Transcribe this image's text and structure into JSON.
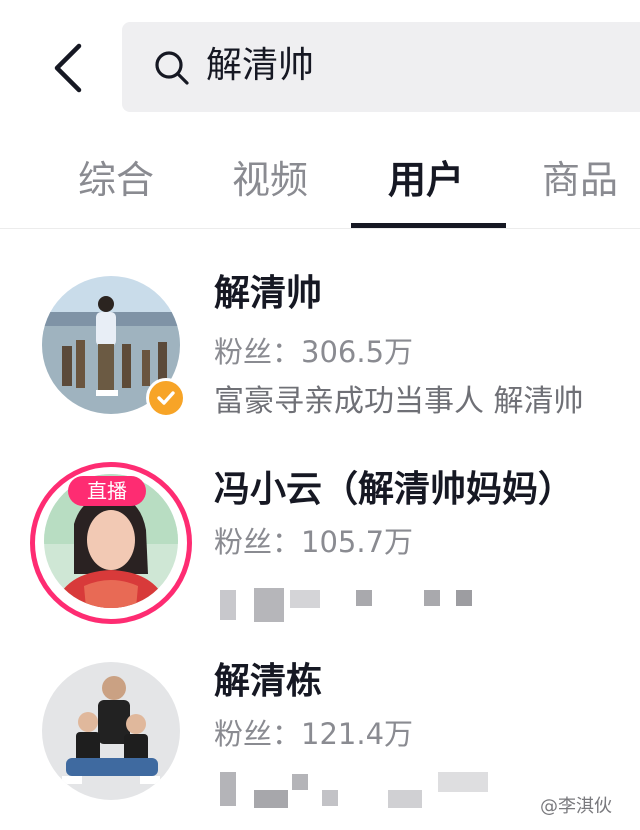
{
  "search": {
    "query": "解清帅"
  },
  "tabs": [
    {
      "label": "综合",
      "active": false
    },
    {
      "label": "视频",
      "active": false
    },
    {
      "label": "用户",
      "active": true
    },
    {
      "label": "商品",
      "active": false
    }
  ],
  "users": [
    {
      "name": "解清帅",
      "fans": "粉丝：306.5万",
      "desc": "富豪寻亲成功当事人 解清帅",
      "verified": true,
      "live": false
    },
    {
      "name": "冯小云（解清帅妈妈）",
      "fans": "粉丝：105.7万",
      "live": true,
      "live_label": "直播"
    },
    {
      "name": "解清栋",
      "fans": "粉丝：121.4万",
      "live": false
    }
  ],
  "watermark": "@李淇伙",
  "colors": {
    "accent_pink": "#fe2c72",
    "verified_orange": "#f7a427",
    "search_bg": "#efeff1"
  }
}
